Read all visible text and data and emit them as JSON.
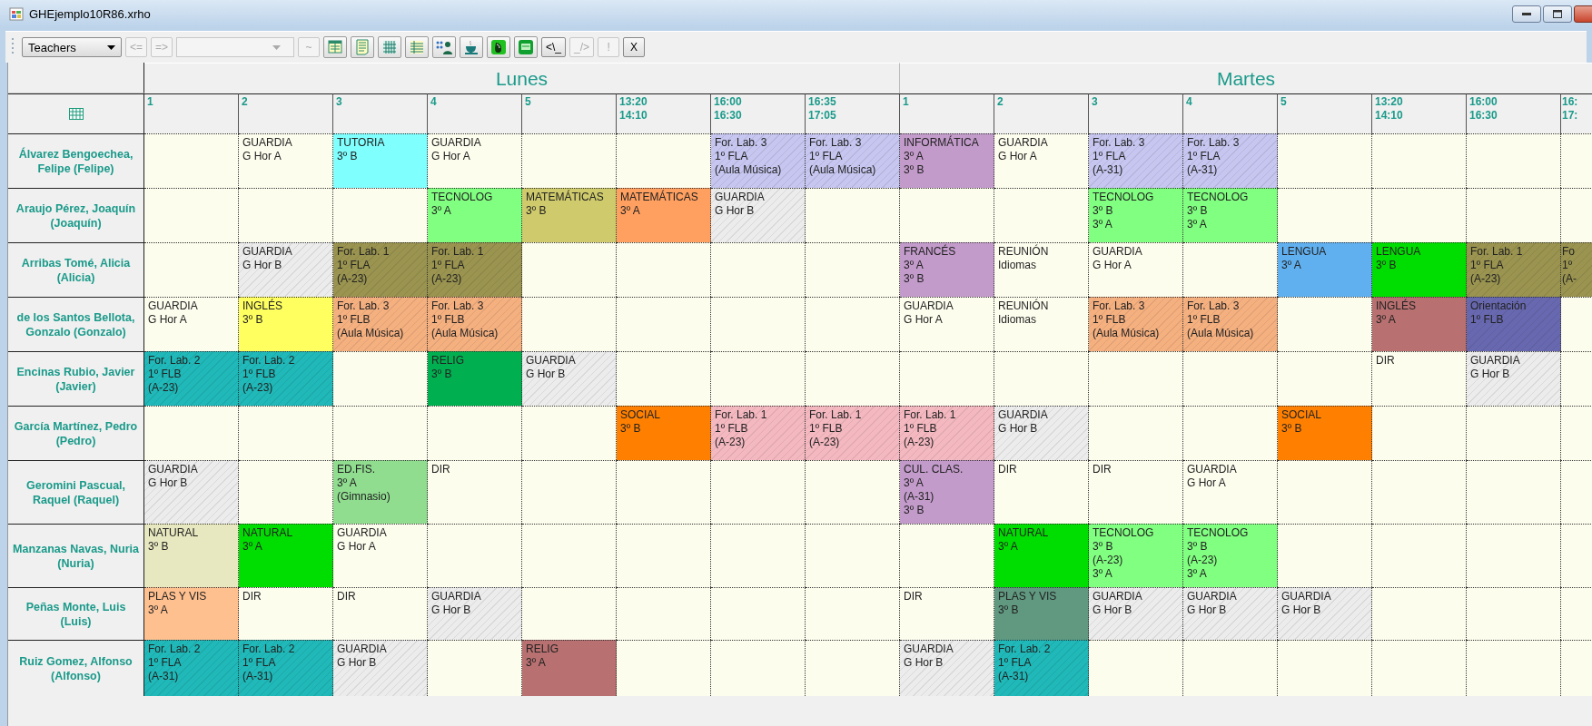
{
  "window": {
    "title": "GHEjemplo10R86.xrho"
  },
  "toolbar": {
    "items": [
      {
        "kind": "select",
        "label": "Teachers",
        "disabled": false
      },
      {
        "kind": "button",
        "label": "<=",
        "disabled": true
      },
      {
        "kind": "button",
        "label": "=>",
        "disabled": true
      },
      {
        "kind": "combo",
        "disabled": true
      },
      {
        "kind": "button",
        "label": "~",
        "disabled": true
      },
      {
        "kind": "icon_button",
        "disabled": false
      },
      {
        "kind": "icon_button",
        "disabled": false
      },
      {
        "kind": "icon_button",
        "disabled": false
      },
      {
        "kind": "icon_button",
        "disabled": false
      },
      {
        "kind": "icon_button",
        "disabled": false
      },
      {
        "kind": "icon_button",
        "disabled": false
      },
      {
        "kind": "icon_button",
        "disabled": false
      },
      {
        "kind": "icon_button",
        "disabled": false
      },
      {
        "kind": "button",
        "label": "<\\_",
        "disabled": false
      },
      {
        "kind": "button",
        "label": "_/>",
        "disabled": true
      },
      {
        "kind": "button",
        "label": "!",
        "disabled": true
      },
      {
        "kind": "button",
        "label": "X",
        "disabled": false
      }
    ]
  },
  "days": [
    {
      "name": "Lunes",
      "slots": [
        [
          "1"
        ],
        [
          "2"
        ],
        [
          "3"
        ],
        [
          "4"
        ],
        [
          "5"
        ],
        [
          "13:20",
          "14:10"
        ],
        [
          "16:00",
          "16:30"
        ],
        [
          "16:35",
          "17:05"
        ]
      ]
    },
    {
      "name": "Martes",
      "slots": [
        [
          "1"
        ],
        [
          "2"
        ],
        [
          "3"
        ],
        [
          "4"
        ],
        [
          "5"
        ],
        [
          "13:20",
          "14:10"
        ],
        [
          "16:00",
          "16:30"
        ],
        [
          "16:",
          "17:"
        ]
      ]
    }
  ],
  "rows": [
    {
      "teacher": "Álvarez Bengoechea, Felipe (Felipe)",
      "cells": [
        {},
        {
          "lines": [
            "GUARDIA",
            "G Hor A"
          ],
          "hatched": false
        },
        {
          "lines": [
            "TUTORIA",
            "3º B"
          ],
          "color": "#80ffff",
          "hatched": false
        },
        {
          "lines": [
            "GUARDIA",
            "G Hor A"
          ],
          "hatched": false
        },
        {},
        {},
        {
          "lines": [
            "For. Lab. 3",
            "1º FLA",
            "(Aula Música)"
          ],
          "color": "#c6c6f0",
          "hatched": true
        },
        {
          "lines": [
            "For. Lab. 3",
            "1º FLA",
            "(Aula Música)"
          ],
          "color": "#c6c6f0",
          "hatched": true
        },
        {
          "lines": [
            "INFORMÁTICA",
            "3º A",
            "3º B"
          ],
          "color": "#c39bcb",
          "hatched": false
        },
        {
          "lines": [
            "GUARDIA",
            "G Hor A"
          ],
          "hatched": false
        },
        {
          "lines": [
            "For. Lab. 3",
            "1º FLA",
            "(A-31)"
          ],
          "color": "#c6c6f0",
          "hatched": true
        },
        {
          "lines": [
            "For. Lab. 3",
            "1º FLA",
            "(A-31)"
          ],
          "color": "#c6c6f0",
          "hatched": true
        },
        {},
        {},
        {},
        {}
      ]
    },
    {
      "teacher": "Araujo Pérez, Joaquín (Joaquín)",
      "cells": [
        {},
        {},
        {},
        {
          "lines": [
            "TECNOLOG",
            "3º A"
          ],
          "color": "#80ff80",
          "hatched": false
        },
        {
          "lines": [
            "MATEMÁTICAS",
            "3º B"
          ],
          "color": "#cfcb6c",
          "hatched": false
        },
        {
          "lines": [
            "MATEMÁTICAS",
            "3º A"
          ],
          "color": "#ffa060",
          "hatched": false
        },
        {
          "lines": [
            "GUARDIA",
            "G Hor B"
          ],
          "color": "#ececec",
          "hatched": true
        },
        {},
        {},
        {},
        {
          "lines": [
            "TECNOLOG",
            "3º B",
            "3º A"
          ],
          "color": "#80ff80",
          "hatched": false
        },
        {
          "lines": [
            "TECNOLOG",
            "3º B",
            "3º A"
          ],
          "color": "#80ff80",
          "hatched": false
        },
        {},
        {},
        {},
        {}
      ]
    },
    {
      "teacher": "Arribas Tomé, Alicia (Alicia)",
      "cells": [
        {},
        {
          "lines": [
            "GUARDIA",
            "G Hor B"
          ],
          "color": "#ececec",
          "hatched": true
        },
        {
          "lines": [
            "For. Lab. 1",
            "1º FLA",
            "(A-23)"
          ],
          "color": "#9a9450",
          "hatched": true
        },
        {
          "lines": [
            "For. Lab. 1",
            "1º FLA",
            "(A-23)"
          ],
          "color": "#9a9450",
          "hatched": true
        },
        {},
        {},
        {},
        {},
        {
          "lines": [
            "FRANCÉS",
            "3º A",
            "3º B"
          ],
          "color": "#c39bcb",
          "hatched": false
        },
        {
          "lines": [
            "REUNIÓN",
            "Idiomas"
          ],
          "hatched": false
        },
        {
          "lines": [
            "GUARDIA",
            "G Hor A"
          ],
          "hatched": false
        },
        {},
        {
          "lines": [
            "LENGUA",
            "3º A"
          ],
          "color": "#60b0f0",
          "hatched": false
        },
        {
          "lines": [
            "LENGUA",
            "3º B"
          ],
          "color": "#00dd00",
          "hatched": false
        },
        {
          "lines": [
            "For. Lab. 1",
            "1º FLA",
            "(A-23)"
          ],
          "color": "#9a9450",
          "hatched": true
        },
        {
          "lines": [
            "Fo",
            "1º",
            "(A-"
          ],
          "color": "#9a9450",
          "hatched": true
        }
      ]
    },
    {
      "teacher": "de los Santos Bellota, Gonzalo (Gonzalo)",
      "cells": [
        {
          "lines": [
            "GUARDIA",
            "G Hor A"
          ],
          "hatched": false
        },
        {
          "lines": [
            "INGLÉS",
            "3º B"
          ],
          "color": "#ffff60",
          "hatched": false
        },
        {
          "lines": [
            "For. Lab. 3",
            "1º FLB",
            "(Aula Música)"
          ],
          "color": "#f5b080",
          "hatched": true
        },
        {
          "lines": [
            "For. Lab. 3",
            "1º FLB",
            "(Aula Música)"
          ],
          "color": "#f5b080",
          "hatched": true
        },
        {},
        {},
        {},
        {},
        {
          "lines": [
            "GUARDIA",
            "G Hor A"
          ],
          "hatched": false
        },
        {
          "lines": [
            "REUNIÓN",
            "Idiomas"
          ],
          "hatched": false
        },
        {
          "lines": [
            "For. Lab. 3",
            "1º FLB",
            "(Aula Música)"
          ],
          "color": "#f5b080",
          "hatched": true
        },
        {
          "lines": [
            "For. Lab. 3",
            "1º FLB",
            "(Aula Música)"
          ],
          "color": "#f5b080",
          "hatched": true
        },
        {},
        {
          "lines": [
            "INGLÉS",
            "3º A"
          ],
          "color": "#b87070",
          "hatched": false
        },
        {
          "lines": [
            "Orientación",
            "1º FLB"
          ],
          "color": "#6868b0",
          "hatched": true
        },
        {}
      ]
    },
    {
      "teacher": "Encinas Rubio, Javier (Javier)",
      "cells": [
        {
          "lines": [
            "For. Lab. 2",
            "1º FLB",
            "(A-23)"
          ],
          "color": "#20b8b8",
          "hatched": true
        },
        {
          "lines": [
            "For. Lab. 2",
            "1º FLB",
            "(A-23)"
          ],
          "color": "#20b8b8",
          "hatched": true
        },
        {},
        {
          "lines": [
            "RELIG",
            "3º B"
          ],
          "color": "#00b050",
          "hatched": false
        },
        {
          "lines": [
            "GUARDIA",
            "G Hor B"
          ],
          "color": "#ececec",
          "hatched": true
        },
        {},
        {},
        {},
        {},
        {},
        {},
        {},
        {},
        {
          "lines": [
            "DIR"
          ],
          "hatched": false
        },
        {
          "lines": [
            "GUARDIA",
            "G Hor B"
          ],
          "color": "#ececec",
          "hatched": true
        },
        {}
      ]
    },
    {
      "teacher": "García Martínez, Pedro (Pedro)",
      "cells": [
        {},
        {},
        {},
        {},
        {},
        {
          "lines": [
            "SOCIAL",
            "3º B"
          ],
          "color": "#ff8000",
          "hatched": false
        },
        {
          "lines": [
            "For. Lab. 1",
            "1º FLB",
            "(A-23)"
          ],
          "color": "#f4b8c0",
          "hatched": true
        },
        {
          "lines": [
            "For. Lab. 1",
            "1º FLB",
            "(A-23)"
          ],
          "color": "#f4b8c0",
          "hatched": true
        },
        {
          "lines": [
            "For. Lab. 1",
            "1º FLB",
            "(A-23)"
          ],
          "color": "#f4b8c0",
          "hatched": true
        },
        {
          "lines": [
            "GUARDIA",
            "G Hor B"
          ],
          "color": "#ececec",
          "hatched": true
        },
        {},
        {},
        {
          "lines": [
            "SOCIAL",
            "3º B"
          ],
          "color": "#ff8000",
          "hatched": false
        },
        {},
        {},
        {}
      ]
    },
    {
      "teacher": "Geromini Pascual, Raquel (Raquel)",
      "cells": [
        {
          "lines": [
            "GUARDIA",
            "G Hor B"
          ],
          "color": "#ececec",
          "hatched": true
        },
        {},
        {
          "lines": [
            "ED.FIS.",
            "3º A",
            "(Gimnasio)"
          ],
          "color": "#90dd90",
          "hatched": false
        },
        {
          "lines": [
            "DIR"
          ],
          "hatched": false
        },
        {},
        {},
        {},
        {},
        {
          "lines": [
            "CUL. CLAS.",
            "3º A",
            "(A-31)",
            "3º B"
          ],
          "color": "#c39bcb",
          "hatched": false
        },
        {
          "lines": [
            "DIR"
          ],
          "hatched": false
        },
        {
          "lines": [
            "DIR"
          ],
          "hatched": false
        },
        {
          "lines": [
            "GUARDIA",
            "G Hor A"
          ],
          "hatched": false
        },
        {},
        {},
        {},
        {}
      ]
    },
    {
      "teacher": "Manzanas Navas, Nuria (Nuria)",
      "cells": [
        {
          "lines": [
            "NATURAL",
            "3º B"
          ],
          "color": "#e8e8c0",
          "hatched": false
        },
        {
          "lines": [
            "NATURAL",
            "3º A"
          ],
          "color": "#00dd00",
          "hatched": false
        },
        {
          "lines": [
            "GUARDIA",
            "G Hor A"
          ],
          "hatched": false
        },
        {},
        {},
        {},
        {},
        {},
        {},
        {
          "lines": [
            "NATURAL",
            "3º A"
          ],
          "color": "#00dd00",
          "hatched": false
        },
        {
          "lines": [
            "TECNOLOG",
            "3º B",
            "(A-23)",
            "3º A"
          ],
          "color": "#80ff80",
          "hatched": false
        },
        {
          "lines": [
            "TECNOLOG",
            "3º B",
            "(A-23)",
            "3º A"
          ],
          "color": "#80ff80",
          "hatched": false
        },
        {},
        {},
        {},
        {}
      ]
    },
    {
      "teacher": "Peñas Monte, Luis (Luis)",
      "cells": [
        {
          "lines": [
            "PLAS Y VIS",
            "3º A"
          ],
          "color": "#ffc090",
          "hatched": false
        },
        {
          "lines": [
            "DIR"
          ],
          "hatched": false
        },
        {
          "lines": [
            "DIR"
          ],
          "hatched": false
        },
        {
          "lines": [
            "GUARDIA",
            "G Hor B"
          ],
          "color": "#ececec",
          "hatched": true
        },
        {},
        {},
        {},
        {},
        {
          "lines": [
            "DIR"
          ],
          "hatched": false
        },
        {
          "lines": [
            "PLAS Y VIS",
            "3º B"
          ],
          "color": "#609880",
          "hatched": false
        },
        {
          "lines": [
            "GUARDIA",
            "G Hor B"
          ],
          "color": "#ececec",
          "hatched": true
        },
        {
          "lines": [
            "GUARDIA",
            "G Hor B"
          ],
          "color": "#ececec",
          "hatched": true
        },
        {
          "lines": [
            "GUARDIA",
            "G Hor B"
          ],
          "color": "#ececec",
          "hatched": true
        },
        {},
        {},
        {}
      ]
    },
    {
      "teacher": "Ruiz Gomez, Alfonso (Alfonso)",
      "cells": [
        {
          "lines": [
            "For. Lab. 2",
            "1º FLA",
            "(A-31)"
          ],
          "color": "#20b8b8",
          "hatched": true
        },
        {
          "lines": [
            "For. Lab. 2",
            "1º FLA",
            "(A-31)"
          ],
          "color": "#20b8b8",
          "hatched": true
        },
        {
          "lines": [
            "GUARDIA",
            "G Hor B"
          ],
          "color": "#ececec",
          "hatched": true
        },
        {},
        {
          "lines": [
            "RELIG",
            "3º A"
          ],
          "color": "#b87070",
          "hatched": false
        },
        {},
        {},
        {},
        {
          "lines": [
            "GUARDIA",
            "G Hor B"
          ],
          "color": "#ececec",
          "hatched": true
        },
        {
          "lines": [
            "For. Lab. 2",
            "1º FLA",
            "(A-31)"
          ],
          "color": "#20b8b8",
          "hatched": true
        },
        {},
        {},
        {},
        {},
        {},
        {}
      ]
    }
  ]
}
